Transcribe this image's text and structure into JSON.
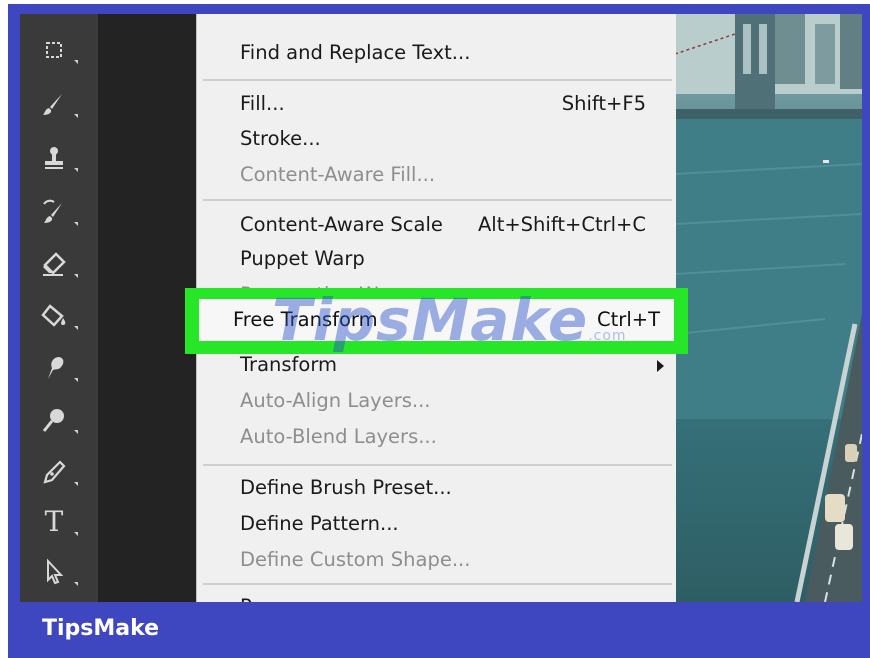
{
  "menu": {
    "items": [
      {
        "label": "Find and Replace Text...",
        "shortcut": "",
        "disabled": false
      },
      {
        "label": "Fill...",
        "shortcut": "Shift+F5",
        "disabled": false
      },
      {
        "label": "Stroke...",
        "shortcut": "",
        "disabled": false
      },
      {
        "label": "Content-Aware Fill...",
        "shortcut": "",
        "disabled": true
      },
      {
        "label": "Content-Aware Scale",
        "shortcut": "Alt+Shift+Ctrl+C",
        "disabled": false
      },
      {
        "label": "Puppet Warp",
        "shortcut": "",
        "disabled": false
      },
      {
        "label": "Perspective Warp",
        "shortcut": "",
        "disabled": true
      },
      {
        "label": "Free Transform",
        "shortcut": "Ctrl+T",
        "disabled": false
      },
      {
        "label": "Transform",
        "shortcut": "",
        "disabled": false
      },
      {
        "label": "Auto-Align Layers...",
        "shortcut": "",
        "disabled": true
      },
      {
        "label": "Auto-Blend Layers...",
        "shortcut": "",
        "disabled": true
      },
      {
        "label": "Define Brush Preset...",
        "shortcut": "",
        "disabled": false
      },
      {
        "label": "Define Pattern...",
        "shortcut": "",
        "disabled": false
      },
      {
        "label": "Define Custom Shape...",
        "shortcut": "",
        "disabled": true
      },
      {
        "label": "Purge",
        "shortcut": "",
        "disabled": false
      }
    ]
  },
  "toolbar": {
    "tools": [
      "artboard-icon",
      "brush-icon",
      "stamp-icon",
      "history-brush-icon",
      "eraser-icon",
      "paint-bucket-icon",
      "smudge-icon",
      "dodge-icon",
      "pen-icon",
      "type-icon",
      "path-select-icon"
    ],
    "type_tool_glyph": "T"
  },
  "watermark": {
    "text": "TipsMake",
    "suffix": ".com"
  },
  "branding": {
    "text": "TipsMake"
  },
  "colors": {
    "highlight": "#27e627",
    "frame": "#3f47c0",
    "menu_bg": "#f0f0f0"
  }
}
